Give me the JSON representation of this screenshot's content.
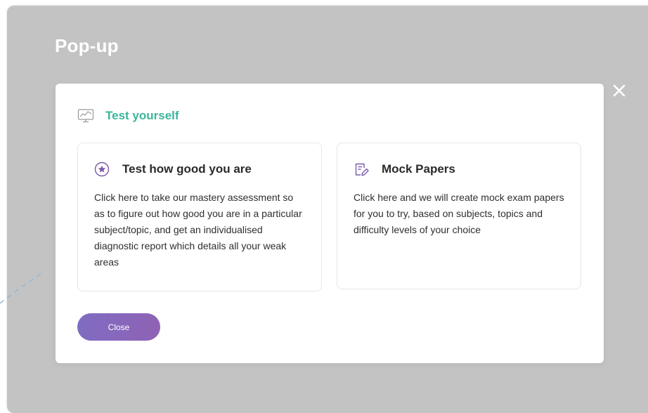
{
  "page": {
    "title": "Pop-up"
  },
  "modal": {
    "header": {
      "title": "Test yourself",
      "icon": "monitor-chart-icon"
    },
    "cards": [
      {
        "title": "Test how good you are",
        "icon": "star-circle-icon",
        "description": "Click here to take our mastery assessment so as to figure out how good you are in a particular subject/topic, and get an individualised diagnostic report which details all your weak areas"
      },
      {
        "title": "Mock Papers",
        "icon": "edit-document-icon",
        "description": "Click here and we will create mock exam papers for you to try, based on subjects, topics and difficulty levels of your choice"
      }
    ],
    "close_button_label": "Close",
    "close_icon": "close-icon"
  },
  "colors": {
    "backdrop": "#c3c3c3",
    "accent_teal": "#3cb49a",
    "accent_purple": "#8467bd",
    "button_gradient_start": "#7f6cc2",
    "button_gradient_end": "#8f62b4"
  }
}
